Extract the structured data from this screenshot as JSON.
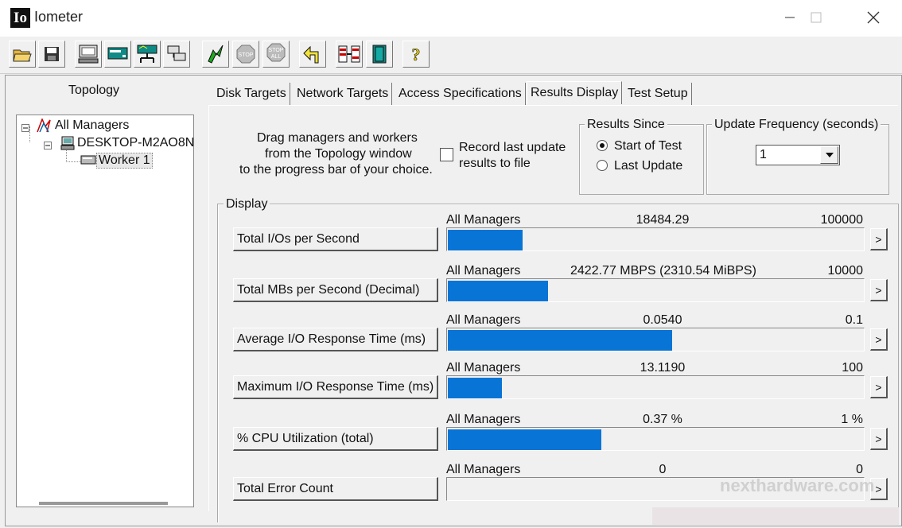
{
  "window": {
    "logo": "Io",
    "title": "Iometer"
  },
  "toolbar": {
    "icons": [
      "open-icon",
      "save-icon",
      "start-new-manager-icon",
      "start-new-worker-icon",
      "copy-worker-icon",
      "start-network-worker-icon",
      "disconnect-icon",
      "start-test-icon",
      "stop-icon",
      "stop-all-icon",
      "reset-workers-icon",
      "exit-icon",
      "about-icon"
    ]
  },
  "topology": {
    "title": "Topology",
    "items": [
      "All Managers",
      "DESKTOP-M2AO8N",
      "Worker 1"
    ]
  },
  "tabs": [
    "Disk Targets",
    "Network Targets",
    "Access Specifications",
    "Results Display",
    "Test Setup"
  ],
  "results": {
    "drag_line1": "Drag managers and workers",
    "drag_line2": "from the Topology window",
    "drag_line3": "to the progress bar of your choice.",
    "record_line1": "Record last update",
    "record_line2": "results to file",
    "results_since_label": "Results Since",
    "since_options": [
      "Start of Test",
      "Last Update"
    ],
    "update_freq_label": "Update Frequency (seconds)",
    "update_freq_value": "1",
    "display_label": "Display"
  },
  "metrics": [
    {
      "name": "Total I/Os per Second",
      "source": "All Managers",
      "value": "18484.29",
      "max": "100000",
      "fraction": 0.18
    },
    {
      "name": "Total MBs per Second (Decimal)",
      "source": "All Managers",
      "value": "2422.77 MBPS (2310.54 MiBPS)",
      "max": "10000",
      "fraction": 0.242
    },
    {
      "name": "Average I/O Response Time (ms)",
      "source": "All Managers",
      "value": "0.0540",
      "max": "0.1",
      "fraction": 0.54
    },
    {
      "name": "Maximum I/O Response Time (ms)",
      "source": "All Managers",
      "value": "13.1190",
      "max": "100",
      "fraction": 0.131
    },
    {
      "name": "% CPU Utilization (total)",
      "source": "All Managers",
      "value": "0.37 %",
      "max": "1 %",
      "fraction": 0.37
    },
    {
      "name": "Total Error Count",
      "source": "All Managers",
      "value": "0",
      "max": "0",
      "fraction": 0
    }
  ],
  "arrow": ">",
  "watermark": "nexthardware.com"
}
